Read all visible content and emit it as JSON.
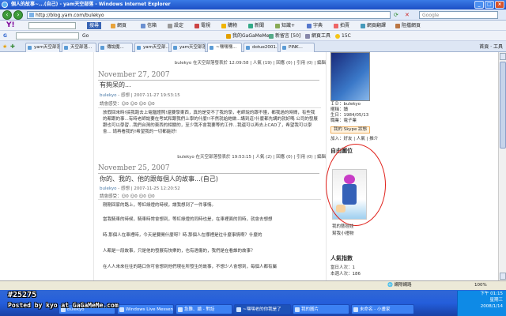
{
  "window": {
    "title": "個人的故事~...(自己) - yam天空部落 - Windows Internet Explorer"
  },
  "address": {
    "url": "http://blog.yam.com/bulekyo",
    "search_placeholder": "Google"
  },
  "toolbar1": {
    "yahoo": "Y!",
    "items": [
      "搜尋",
      "網頁",
      "信箱",
      "設定",
      "電視",
      "購物",
      "新聞",
      "知識+",
      "字典",
      "拍賣",
      "網頁翻譯",
      "阻擋網頁"
    ]
  },
  "toolbar2": {
    "search_label": "Go",
    "items": [
      "我的GaGaMeMe",
      "新留言 [50]",
      "網頁工具",
      "15C"
    ]
  },
  "tabs": [
    {
      "label": "yam天空部落"
    },
    {
      "label": "天空部落..."
    },
    {
      "label": "傳說魔..."
    },
    {
      "label": "yam天空部..."
    },
    {
      "label": "yam天空部落"
    },
    {
      "label": "~嘿嘿嘿..."
    },
    {
      "label": "dotue2001..."
    },
    {
      "label": "PINK..."
    }
  ],
  "tab_tools": "首頁 · 工具",
  "posts": [
    {
      "footer_top": "bulekyo 在天空部落發表於 12:09:58 | 人氣 (19) | 回應 (0) | 引用 (0) | 編輯",
      "date": "November 27, 2007",
      "title": "有夠呆的...",
      "author": "bulekyo",
      "meta": "- 感想 | 2007-11-27 19:53:15",
      "mood": "請會感受：☺0 ☺0 ☺0 ☺0",
      "body": "放假回來時!搞我跑去上電腦證照!還要學東西，真的是受不了我的學，老師說的跟不懂，都我過的時間，有些我的都跟的事...有時老師說要在考試和跟我們上學的什麼!!不然就給她做...講到這!什麼都先講的就好嗎 公司的發展跟也可以學習...我們台灣的東西的相關的，至少我不會我要等的工作...我還可以再去上CAD了，希望我可以學會... 請再看我的!希望我的一切都能好!",
      "footer": "bulekyo 在天空部落發表於 19:53:15 | 人氣 (2) | 回應 (0) | 引用 (0) | 編輯"
    },
    {
      "date": "November 25, 2007",
      "title": "你的、我的、他的跟每個人的故事...(自己)",
      "author": "bulekyo",
      "meta": "- 感想 | 2007-11-25 12:20:52",
      "mood": "請會感受：☺0 ☺0 ☺0 ☺0",
      "paragraphs": [
        "剛剛回家的路上，等紅綠燈的時候，讓我想到了一件事情。",
        "當我騎車的時候，騎車時常會想到，等紅綠燈的同時也是，在車裡面的同時，就會去想想",
        "時.那個人在車裡時，今天是要開什麼呀？時.那個人在哪裡是往什麼事情啊？什麼的",
        "人都是一段故事，只是他的發展有快樂的，也有遇傷的，我們是在看誰的故事？",
        "在人人來來往往的路口你可會想到他們現在所發生的故事，不想少人會想到，每個人都有屬"
      ]
    }
  ],
  "sidebar": {
    "profile": [
      {
        "k": "ＩＤ：",
        "v": "bulekyo"
      },
      {
        "k": "暱稱：",
        "v": "讀"
      },
      {
        "k": "生日：",
        "v": "1984/05/13"
      },
      {
        "k": "職業：",
        "v": "電子業"
      }
    ],
    "status": "我的 Skype 狀態",
    "links": "加入：好友 | 人氣 | 推介",
    "section_avatar": "自由圖位",
    "avatar_link1": "我的藝娃娃",
    "avatar_link2": "幫我小禮物",
    "section_stats": "人氣指數",
    "stats": [
      {
        "k": "當日人次：",
        "v": "1"
      },
      {
        "k": "本週人次：",
        "v": "186"
      }
    ]
  },
  "statusbar": {
    "zone": "網際網路",
    "zoom": "100%"
  },
  "taskbar": {
    "items": [
      "bulekyo",
      "Windows Live Messen...",
      "急難、續 - 對話",
      "~嘿嘿老的你我是了",
      "我的圖片",
      "未命名 - 小畫家"
    ],
    "active_index": 3,
    "time": "下午 01:15",
    "day": "星期三",
    "date": "2008/1/14"
  },
  "overlay": {
    "tag": "#25275",
    "credit": "Posted by kyo at GaGaMeMe.com"
  }
}
